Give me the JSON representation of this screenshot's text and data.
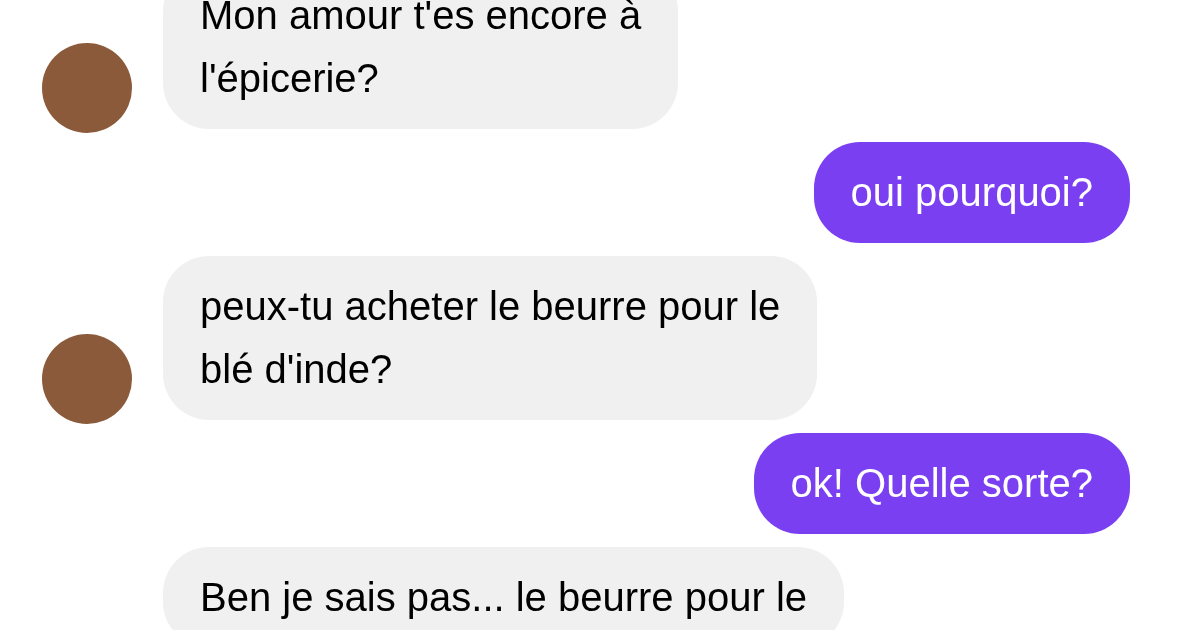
{
  "messages": [
    {
      "kind": "received",
      "avatar": true,
      "text": "Mon amour t'es encore à\nl'épicerie?"
    },
    {
      "kind": "sent",
      "text": "oui pourquoi?"
    },
    {
      "kind": "received",
      "avatar": true,
      "text": "peux-tu acheter le beurre pour le\nblé d'inde?"
    },
    {
      "kind": "sent",
      "text": "ok! Quelle sorte?"
    },
    {
      "kind": "received",
      "avatar": false,
      "text": "Ben je sais pas... le beurre pour le"
    }
  ]
}
